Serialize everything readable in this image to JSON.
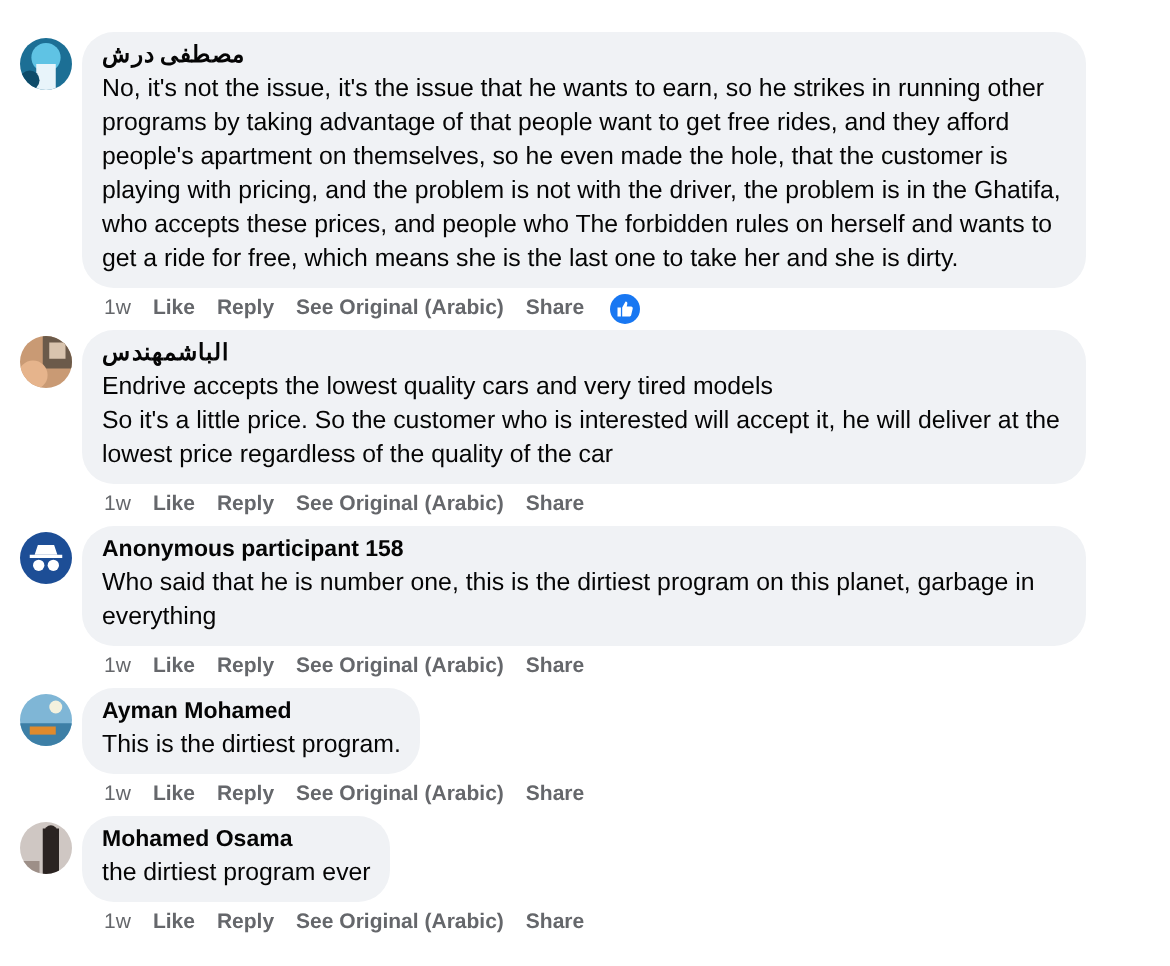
{
  "comments": [
    {
      "author": "مصطفى درش",
      "text": "No, it's not the issue, it's the issue that he wants to earn, so he strikes in running other programs by taking advantage of that people want to get free rides, and they afford people's apartment on themselves, so he even made the hole, that the customer is playing with pricing, and the problem is not with the driver, the problem is in the Ghatifa, who accepts these prices, and people who The forbidden rules on herself and wants to get a ride for free, which means she is the last one to take her and she is dirty.",
      "actions": {
        "time": "1w",
        "like": "Like",
        "reply": "Reply",
        "translate": "See Original (Arabic)",
        "share": "Share"
      },
      "reacted": true
    },
    {
      "author": "الباشمهندس",
      "text": "Endrive accepts the lowest quality cars and very tired models\nSo it's a little price. So the customer who is interested will accept it, he will deliver at the lowest price regardless of the quality of the car",
      "actions": {
        "time": "1w",
        "like": "Like",
        "reply": "Reply",
        "translate": "See Original (Arabic)",
        "share": "Share"
      },
      "reacted": false
    },
    {
      "avatar": {
        "kind": "anonymous"
      },
      "author": "Anonymous participant 158",
      "text": "Who said that he is number one, this is the dirtiest program on this planet, garbage in everything",
      "actions": {
        "time": "1w",
        "like": "Like",
        "reply": "Reply",
        "translate": "See Original (Arabic)",
        "share": "Share"
      },
      "reacted": false
    },
    {
      "author": "Ayman Mohamed",
      "text": "This is the dirtiest program.",
      "actions": {
        "time": "1w",
        "like": "Like",
        "reply": "Reply",
        "translate": "See Original (Arabic)",
        "share": "Share"
      },
      "reacted": false
    },
    {
      "author": "Mohamed Osama",
      "text": "the dirtiest program ever",
      "actions": {
        "time": "1w",
        "like": "Like",
        "reply": "Reply",
        "translate": "See Original (Arabic)",
        "share": "Share"
      },
      "reacted": false
    }
  ]
}
